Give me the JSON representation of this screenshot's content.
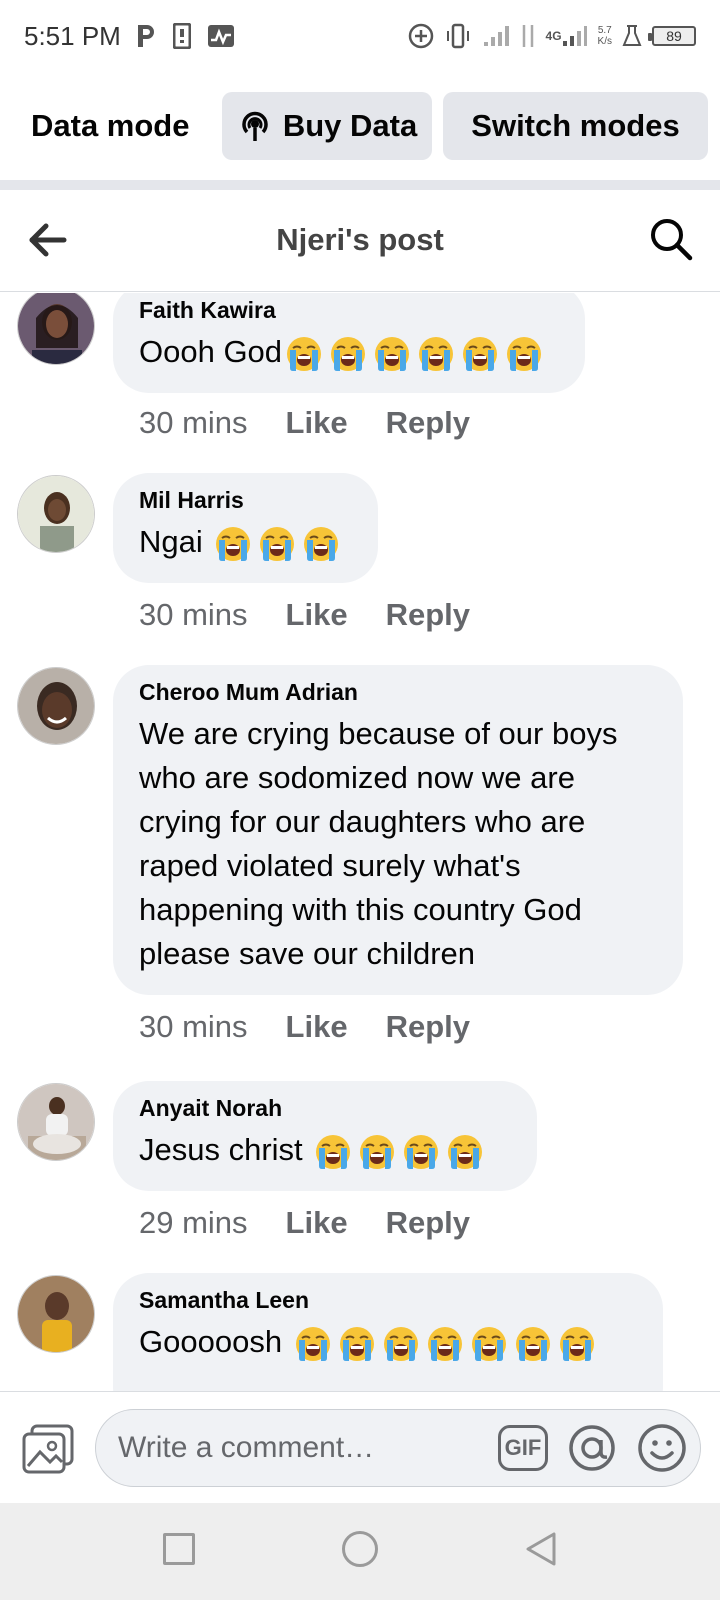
{
  "status_bar": {
    "time": "5:51 PM",
    "network_type": "4G",
    "speed_value": "5.7",
    "speed_unit": "K/s",
    "battery": "89"
  },
  "data_mode": {
    "label": "Data mode",
    "buy_data": "Buy Data",
    "switch_modes": "Switch modes"
  },
  "header": {
    "title": "Njeri's post"
  },
  "comments": [
    {
      "author": "Faith Kawira",
      "text": "Oooh God",
      "emoji_count": 6,
      "time": "30 mins",
      "like": "Like",
      "reply": "Reply",
      "avatar_color": "#3a2a2a"
    },
    {
      "author": "Mil Harris",
      "text": "Ngai",
      "emoji_count": 3,
      "time": "30 mins",
      "like": "Like",
      "reply": "Reply",
      "avatar_color": "#d8dccc"
    },
    {
      "author": "Cheroo Mum Adrian",
      "text": "We are crying because of our boys who are sodomized now we are crying for our daughters who are raped violated surely what's happening with this country God please save our children",
      "emoji_count": 0,
      "time": "30 mins",
      "like": "Like",
      "reply": "Reply",
      "avatar_color": "#4a3a3a"
    },
    {
      "author": "Anyait Norah",
      "text": "Jesus christ",
      "emoji_count": 4,
      "time": "29 mins",
      "like": "Like",
      "reply": "Reply",
      "avatar_color": "#b0a090"
    },
    {
      "author": "Samantha Leen",
      "text": "Gooooosh",
      "emoji_count": 7,
      "time": "",
      "like": "",
      "reply": "",
      "avatar_color": "#c89a30"
    }
  ],
  "composer": {
    "placeholder": "Write a comment…",
    "gif": "GIF"
  },
  "icons": {
    "emoji": "loudly-crying-face",
    "back": "arrow-left-icon",
    "search": "search-icon"
  }
}
